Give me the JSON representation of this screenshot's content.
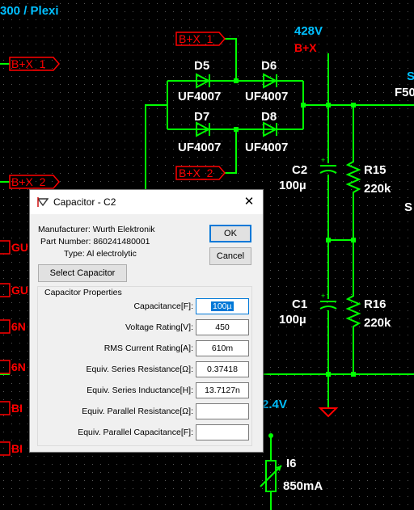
{
  "schematic": {
    "corner_title": "300 / Plexi",
    "voltage_top": "428V",
    "bplus_x": "B+X",
    "net_bx1_left": "B+X_1",
    "net_bx1_top": "B+X_1",
    "net_bx2_left": "B+X_2",
    "net_bx2_mid": "B+X_2",
    "diodes": [
      {
        "ref": "D5",
        "value": "UF4007"
      },
      {
        "ref": "D6",
        "value": "UF4007"
      },
      {
        "ref": "D7",
        "value": "UF4007"
      },
      {
        "ref": "D8",
        "value": "UF4007"
      }
    ],
    "c2_ref": "C2",
    "c2_value": "100µ",
    "c1_ref": "C1",
    "c1_value": "100µ",
    "r15_ref": "R15",
    "r15_value": "220k",
    "r16_ref": "R16",
    "r16_value": "220k",
    "edge_s1": "S",
    "edge_f": "F50",
    "edge_s2": "S",
    "left_labels": [
      "GU",
      "GU",
      "6N",
      "6N",
      "BI",
      "BI"
    ],
    "voltage_bottom": "2.4V",
    "i6_ref": "I6",
    "i6_value": "850mA"
  },
  "dialog": {
    "title": "Capacitor - C2",
    "close_glyph": "✕",
    "manufacturer": "Manufacturer: Wurth Elektronik",
    "part_number": "Part Number: 860241480001",
    "type": "Type: Al electrolytic",
    "ok_label": "OK",
    "cancel_label": "Cancel",
    "select_label": "Select Capacitor",
    "group_label": "Capacitor Properties",
    "props": [
      {
        "label": "Capacitance[F]:",
        "value": "100µ"
      },
      {
        "label": "Voltage Rating[V]:",
        "value": "450"
      },
      {
        "label": "RMS Current Rating[A]:",
        "value": "610m"
      },
      {
        "label": "Equiv. Series Resistance[Ω]:",
        "value": "0.37418"
      },
      {
        "label": "Equiv. Series Inductance[H]:",
        "value": "13.7127n"
      },
      {
        "label": "Equiv. Parallel Resistance[Ω]:",
        "value": ""
      },
      {
        "label": "Equiv. Parallel Capacitance[F]:",
        "value": ""
      }
    ]
  },
  "colors": {
    "background": "#000000",
    "wire": "#00ff00",
    "junction": "#00ff00",
    "net_label": "#ff0000",
    "text": "#ffffff",
    "voltage": "#00bfff",
    "accent": "#0078d7"
  }
}
